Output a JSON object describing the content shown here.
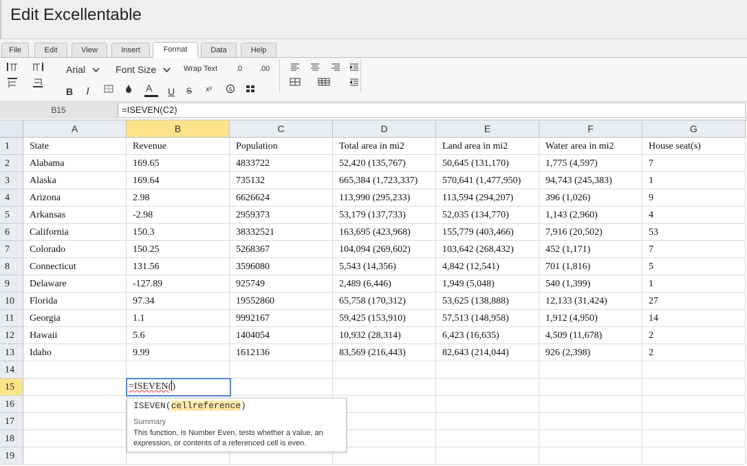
{
  "app": {
    "title": "Edit Excellentable"
  },
  "menu": [
    "File",
    "Edit",
    "View",
    "Insert",
    "Format",
    "Data",
    "Help"
  ],
  "toolbar": {
    "font": "Arial",
    "font_size": "Font Size",
    "wrap_text": "Wrap Text",
    "decimal_decrease": ".0",
    "decimal_increase": ".00",
    "bold": "B",
    "italic": "I",
    "font_color": "A",
    "underline": "U",
    "strikethrough": "S",
    "superscript": "x²"
  },
  "formula_bar": {
    "cell_ref": "B15",
    "formula": "=ISEVEN(C2)"
  },
  "columns": [
    "A",
    "B",
    "C",
    "D",
    "E",
    "F",
    "G"
  ],
  "rows": [
    [
      "State",
      "Revenue",
      "Population",
      "Total area in mi2",
      "Land area in mi2",
      "Water area in mi2",
      "House seat(s)"
    ],
    [
      "Alabama",
      "169.65",
      "4833722",
      "52,420 (135,767)",
      "50,645 (131,170)",
      "1,775 (4,597)",
      "7"
    ],
    [
      "Alaska",
      "169.64",
      "735132",
      "665,384 (1,723,337)",
      "570,641 (1,477,950)",
      "94,743 (245,383)",
      "1"
    ],
    [
      "Arizona",
      "2.98",
      "6626624",
      "113,990 (295,233)",
      "113,594 (294,207)",
      "396 (1,026)",
      "9"
    ],
    [
      "Arkansas",
      "-2.98",
      "2959373",
      "53,179 (137,733)",
      "52,035 (134,770)",
      "1,143 (2,960)",
      "4"
    ],
    [
      "California",
      "150.3",
      "38332521",
      "163,695 (423,968)",
      "155,779 (403,466)",
      "7,916 (20,502)",
      "53"
    ],
    [
      "Colorado",
      "150.25",
      "5268367",
      "104,094 (269,602)",
      "103,642 (268,432)",
      "452 (1,171)",
      "7"
    ],
    [
      "Connecticut",
      "131.56",
      "3596080",
      "5,543 (14,356)",
      "4,842 (12,541)",
      "701 (1,816)",
      "5"
    ],
    [
      "Delaware",
      "-127.89",
      "925749",
      "2,489 (6,446)",
      "1,949 (5,048)",
      "540 (1,399)",
      "1"
    ],
    [
      "Florida",
      "97.34",
      "19552860",
      "65,758 (170,312)",
      "53,625 (138,888)",
      "12,133 (31,424)",
      "27"
    ],
    [
      "Georgia",
      "1.1",
      "9992167",
      "59,425 (153,910)",
      "57,513 (148,958)",
      "1,912 (4,950)",
      "14"
    ],
    [
      "Hawaii",
      "5.6",
      "1404054",
      "10,932 (28,314)",
      "6,423 (16,635)",
      "4,509 (11,678)",
      "2"
    ],
    [
      "Idaho",
      "9.99",
      "1612136",
      "83,569 (216,443)",
      "82,643 (214,044)",
      "926 (2,398)",
      "2"
    ],
    [
      "",
      "",
      "",
      "",
      "",
      "",
      ""
    ],
    [
      "",
      "",
      "",
      "",
      "",
      "",
      ""
    ],
    [
      "",
      "",
      "",
      "",
      "",
      "",
      ""
    ],
    [
      "",
      "",
      "",
      "",
      "",
      "",
      ""
    ],
    [
      "",
      "",
      "",
      "",
      "",
      "",
      ""
    ],
    [
      "",
      "",
      "",
      "",
      "",
      "",
      ""
    ]
  ],
  "row_numbers": [
    "1",
    "2",
    "3",
    "4",
    "5",
    "6",
    "7",
    "8",
    "9",
    "10",
    "11",
    "12",
    "13",
    "14",
    "15",
    "16",
    "17",
    "18",
    "19"
  ],
  "selected": {
    "column": "B",
    "row": "15"
  },
  "editor": {
    "text": "=ISEVEN(",
    "after_caret": ")"
  },
  "tooltip": {
    "function": "ISEVEN(",
    "argument": "cellreference",
    "close": ")",
    "summary_heading": "Summary",
    "summary": "This function, Is Number Even, tests whether a value, an expression, or contents of a referenced cell is even."
  },
  "colors": {
    "selection_header": "#fde38a",
    "editor_border": "#4a88d8"
  }
}
